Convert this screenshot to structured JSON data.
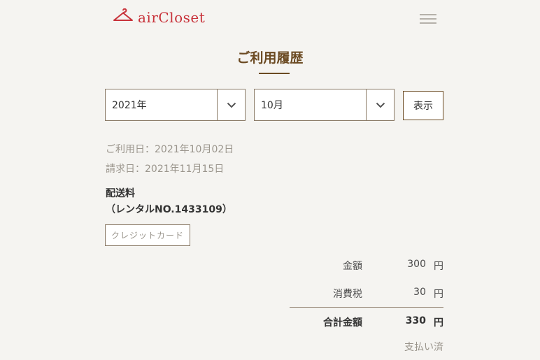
{
  "header": {
    "logo_text": "airCloset"
  },
  "page_title": "ご利用履歴",
  "filters": {
    "year_value": "2021年",
    "month_value": "10月",
    "show_button_label": "表示"
  },
  "record": {
    "use_date": "ご利用日：2021年10月02日",
    "bill_date": "請求日：2021年11月15日",
    "item_title": "配送料",
    "item_rental_no": "（レンタルNO.1433109）",
    "payment_method": "クレジットカード"
  },
  "summary": {
    "amount_label": "金額",
    "amount_value": "300",
    "tax_label": "消費税",
    "tax_value": "30",
    "total_label": "合計金額",
    "total_value": "330",
    "currency": "円",
    "status": "支払い済"
  },
  "colors": {
    "brand": "#c8323a",
    "title": "#6b4a22",
    "background": "#f5f4f1"
  }
}
